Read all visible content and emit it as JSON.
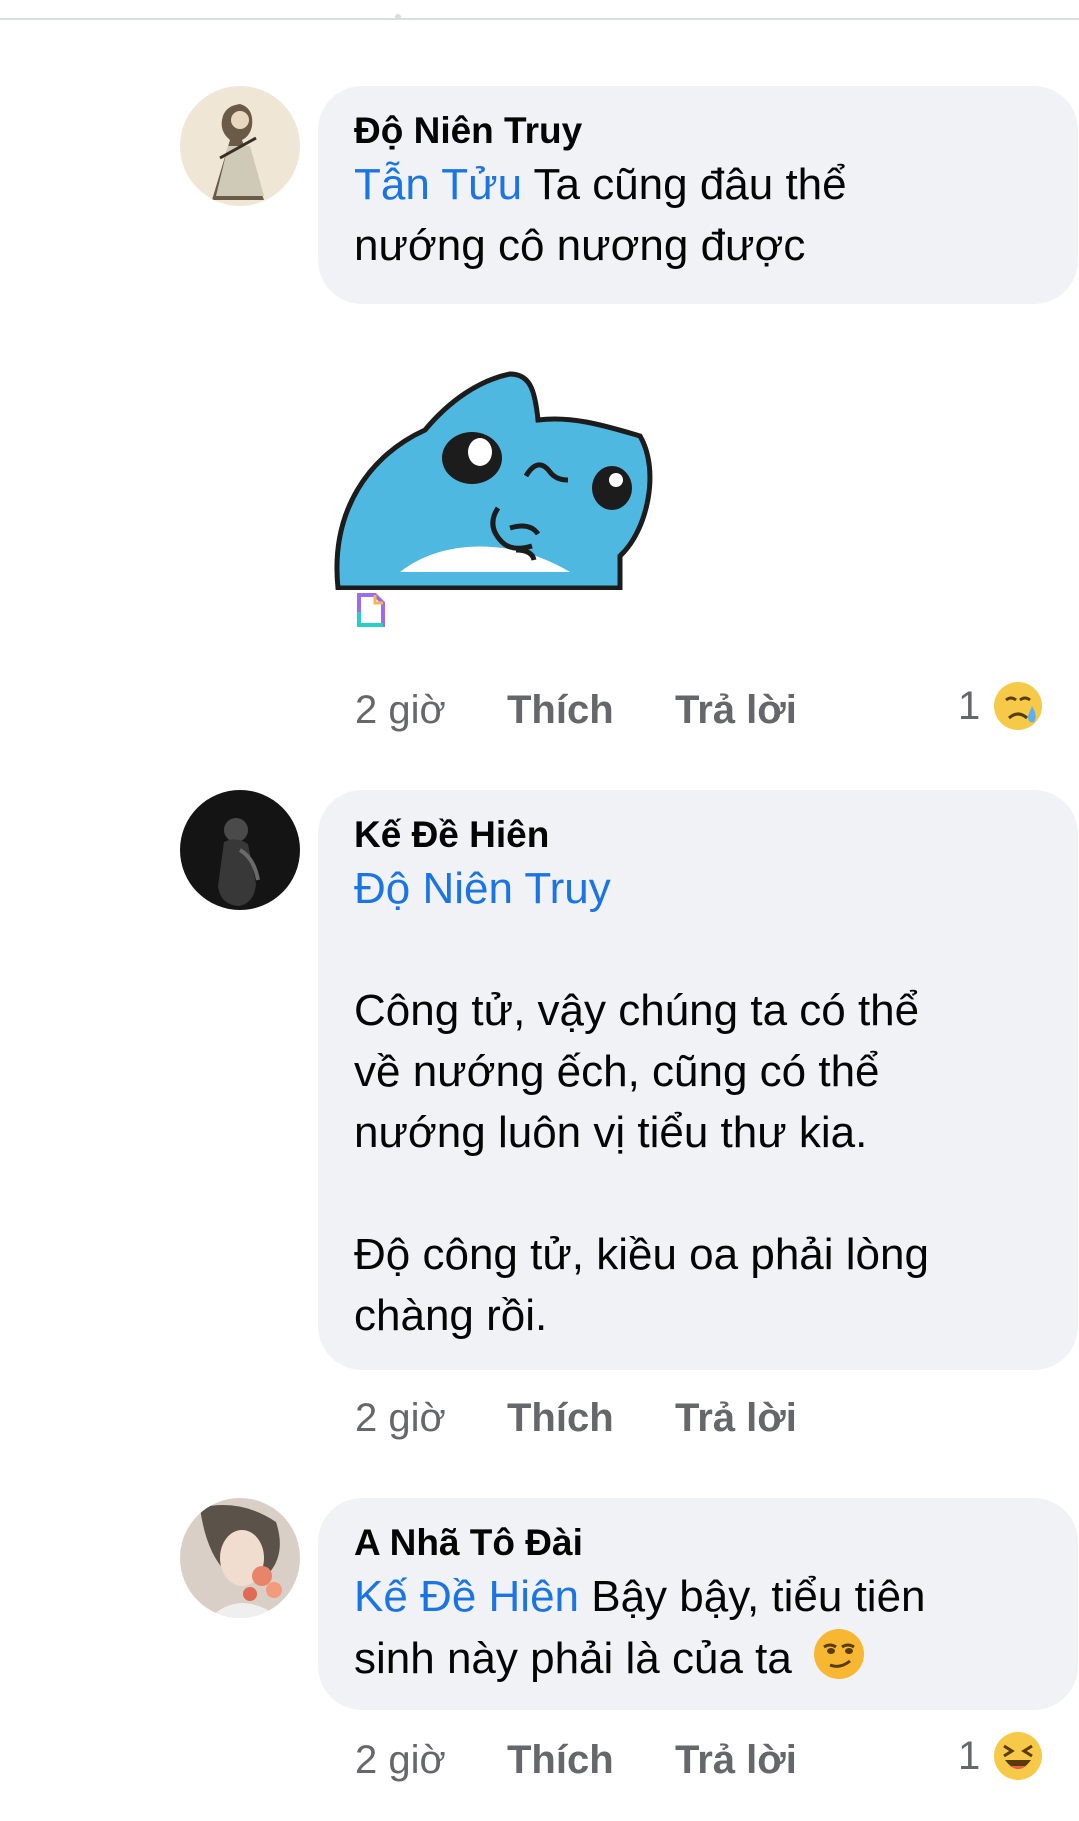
{
  "comments": [
    {
      "author": "Độ Niên Truy",
      "mention": "Tẫn Tửu",
      "text_line1": " Ta cũng đâu thể",
      "text_line2": "nướng cô nương được",
      "time": "2 giờ",
      "like_label": "Thích",
      "reply_label": "Trả lời",
      "reaction_count": "1",
      "reaction_icon": "crying-face-icon",
      "sticker_icon": "blue-cartoon-cat-sticker"
    },
    {
      "author": "Kế Đề Hiên",
      "mention": "Độ Niên Truy",
      "para1_line1": "Công tử, vậy chúng ta có thể",
      "para1_line2": "về nướng ếch, cũng có thể",
      "para1_line3": "nướng luôn vị tiểu thư kia.",
      "para2_line1": "Độ công tử, kiều oa phải lòng",
      "para2_line2": "chàng rồi.",
      "time": "2 giờ",
      "like_label": "Thích",
      "reply_label": "Trả lời"
    },
    {
      "author": "A Nhã Tô Đài",
      "mention": "Kế Đề Hiên",
      "text_line1": " Bậy bậy, tiểu tiên",
      "text_line2": "sinh này phải là của ta",
      "text_emoji": "smirking-face-icon",
      "time": "2 giờ",
      "like_label": "Thích",
      "reply_label": "Trả lời",
      "reaction_count": "1",
      "reaction_icon": "laughing-face-icon"
    }
  ],
  "colors": {
    "bubble_bg": "#f0f2f5",
    "mention": "#1b74e4",
    "secondary_text": "#65676b",
    "sticker_blue": "#4fb8e0"
  }
}
